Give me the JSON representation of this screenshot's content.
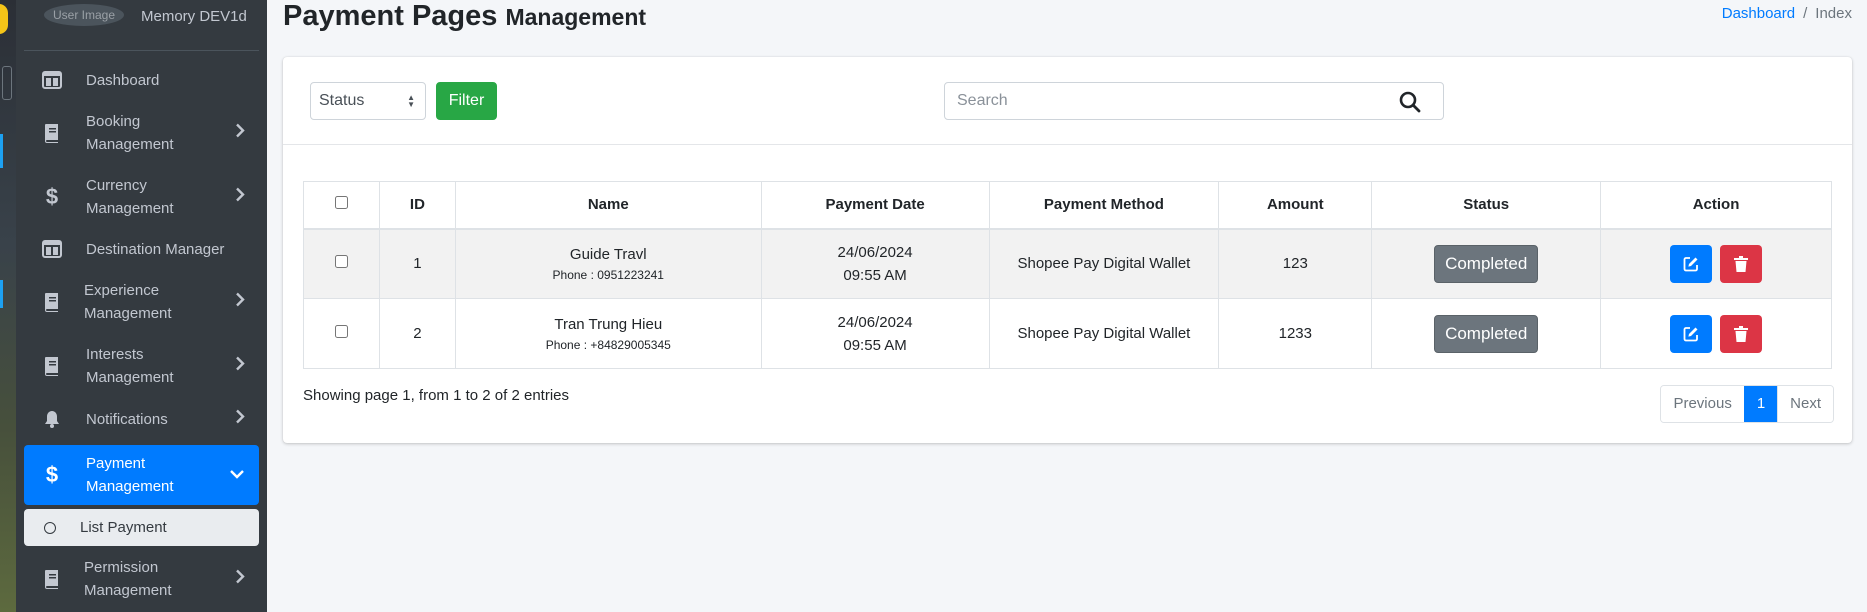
{
  "sidebar": {
    "user_image_alt": "User Image",
    "user_name": "Memory DEV1d",
    "items": [
      {
        "label": "Dashboard",
        "icon": "dashboard-icon"
      },
      {
        "label": "Booking\nManagement",
        "icon": "book-icon"
      },
      {
        "label": "Currency\nManagement",
        "icon": "dollar-icon"
      },
      {
        "label": "Destination Manager",
        "icon": "dashboard-icon"
      },
      {
        "label": "Experience\nManagement",
        "icon": "book-icon"
      },
      {
        "label": "Interests\nManagement",
        "icon": "book-icon"
      },
      {
        "label": "Notifications",
        "icon": "bell-icon"
      },
      {
        "label": "Payment\nManagement",
        "icon": "dollar-icon",
        "active": true
      },
      {
        "label": "Permission\nManagement",
        "icon": "book-icon"
      }
    ],
    "sub_items": [
      {
        "label": "List Payment"
      }
    ]
  },
  "header": {
    "title": "Payment Pages",
    "subtitle": "Management",
    "breadcrumb": {
      "home": "Dashboard",
      "separator": "/",
      "current": "Index"
    }
  },
  "toolbar": {
    "status_select": "Status",
    "filter_label": "Filter",
    "search_placeholder": "Search"
  },
  "table": {
    "columns": [
      "ID",
      "Name",
      "Payment Date",
      "Payment Method",
      "Amount",
      "Status",
      "Action"
    ],
    "rows": [
      {
        "id": "1",
        "name": "Guide Travl",
        "phone": "Phone : 0951223241",
        "date": "24/06/2024",
        "time": "09:55 AM",
        "method": "Shopee Pay Digital Wallet",
        "amount": "123",
        "status": "Completed"
      },
      {
        "id": "2",
        "name": "Tran Trung Hieu",
        "phone": "Phone : +84829005345",
        "date": "24/06/2024",
        "time": "09:55 AM",
        "method": "Shopee Pay Digital Wallet",
        "amount": "1233",
        "status": "Completed"
      }
    ]
  },
  "footer": {
    "info": "Showing page 1, from 1 to 2 of 2 entries",
    "pagination": {
      "previous": "Previous",
      "current": "1",
      "next": "Next"
    }
  },
  "colors": {
    "primary": "#007bff",
    "success": "#28a745",
    "danger": "#dc3545",
    "secondary": "#6c757d",
    "sidebar": "#343a40"
  }
}
